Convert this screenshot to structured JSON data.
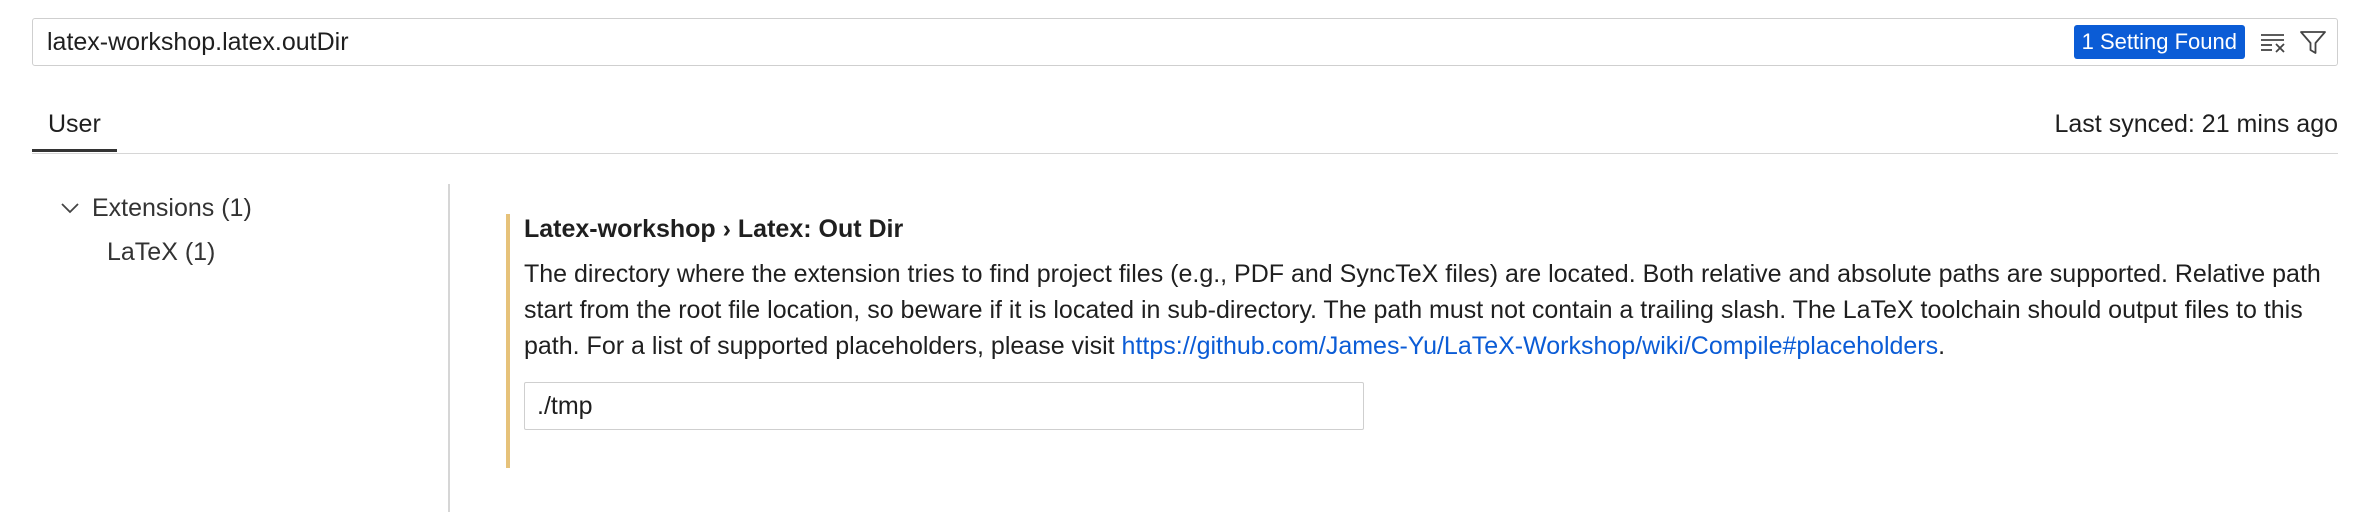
{
  "search": {
    "value": "latex-workshop.latex.outDir",
    "results_badge": "1 Setting Found",
    "clear_icon": "clear-filter-icon",
    "filter_icon": "filter-icon"
  },
  "tabs": {
    "user_label": "User",
    "sync_status": "Last synced: 21 mins ago"
  },
  "toc": {
    "group_label": "Extensions (1)",
    "child_label": "LaTeX (1)"
  },
  "setting": {
    "category": "Latex-workshop › Latex: ",
    "name": "Out Dir",
    "description": "The directory where the extension tries to find project files (e.g., PDF and SyncTeX files) are located. Both relative and absolute paths are supported. Relative path start from the root file location, so beware if it is located in sub-directory. The path must not contain a trailing slash. The LaTeX toolchain should output files to this path. For a list of supported placeholders, please visit ",
    "link_text": "https://github.com/James-Yu/LaTeX-Workshop/wiki/Compile#placeholders",
    "description_end": ".",
    "value": "./tmp",
    "modified_color": "#e6c27a"
  },
  "colors": {
    "accent": "#0b5cd6",
    "link": "#0b5cd6"
  }
}
